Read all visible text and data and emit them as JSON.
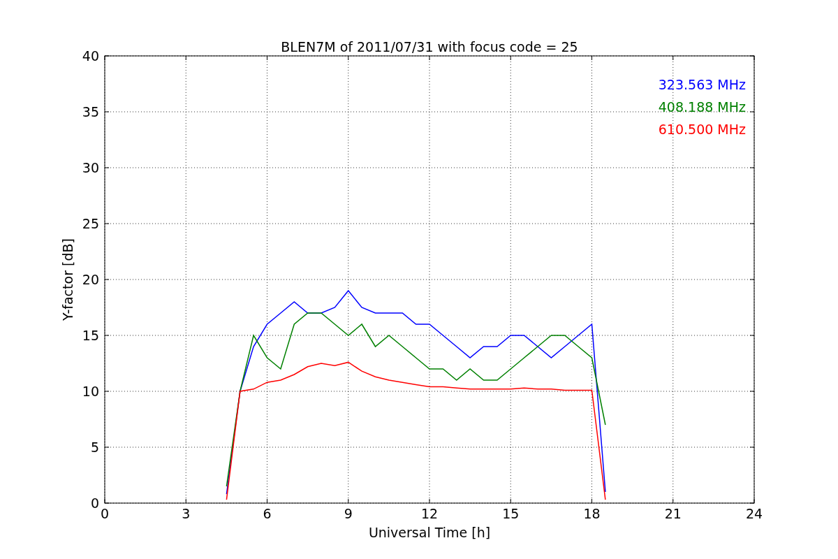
{
  "chart_data": {
    "type": "line",
    "title": "BLEN7M of 2011/07/31 with focus code = 25",
    "xlabel": "Universal Time [h]",
    "ylabel": "Y-factor [dB]",
    "x": [
      4.5,
      5,
      5.5,
      6,
      6.5,
      7,
      7.5,
      8,
      8.5,
      9,
      9.5,
      10,
      10.5,
      11,
      11.5,
      12,
      12.5,
      13,
      13.5,
      14,
      14.5,
      15,
      15.5,
      16,
      16.5,
      17,
      17.5,
      18,
      18.5
    ],
    "series": [
      {
        "name": "323.563 MHz",
        "color": "#0000ff",
        "values": [
          0.8,
          10,
          14,
          16,
          17,
          18,
          17,
          17,
          17.5,
          19,
          17.5,
          17,
          17,
          17,
          16,
          16,
          15,
          14,
          13,
          14,
          14,
          15,
          15,
          14,
          13,
          14,
          15,
          16,
          1
        ]
      },
      {
        "name": "408.188 MHz",
        "color": "#008000",
        "values": [
          1.5,
          10,
          15,
          13,
          12,
          16,
          17,
          17,
          16,
          15,
          16,
          14,
          15,
          14,
          13,
          12,
          12,
          11,
          12,
          11,
          11,
          12,
          13,
          14,
          15,
          15,
          14,
          13,
          7
        ]
      },
      {
        "name": "610.500 MHz",
        "color": "#ff0000",
        "values": [
          0.3,
          10,
          10.2,
          10.8,
          11,
          11.5,
          12.2,
          12.5,
          12.3,
          12.6,
          11.8,
          11.3,
          11,
          10.8,
          10.6,
          10.4,
          10.4,
          10.3,
          10.2,
          10.2,
          10.2,
          10.2,
          10.3,
          10.2,
          10.2,
          10.1,
          10.1,
          10.1,
          0.3
        ]
      }
    ],
    "grid": true,
    "xlim": [
      0,
      24
    ],
    "ylim": [
      0,
      40
    ],
    "xticks": [
      0,
      3,
      6,
      9,
      12,
      15,
      18,
      21,
      24
    ],
    "yticks": [
      0,
      5,
      10,
      15,
      20,
      25,
      30,
      35,
      40
    ]
  }
}
